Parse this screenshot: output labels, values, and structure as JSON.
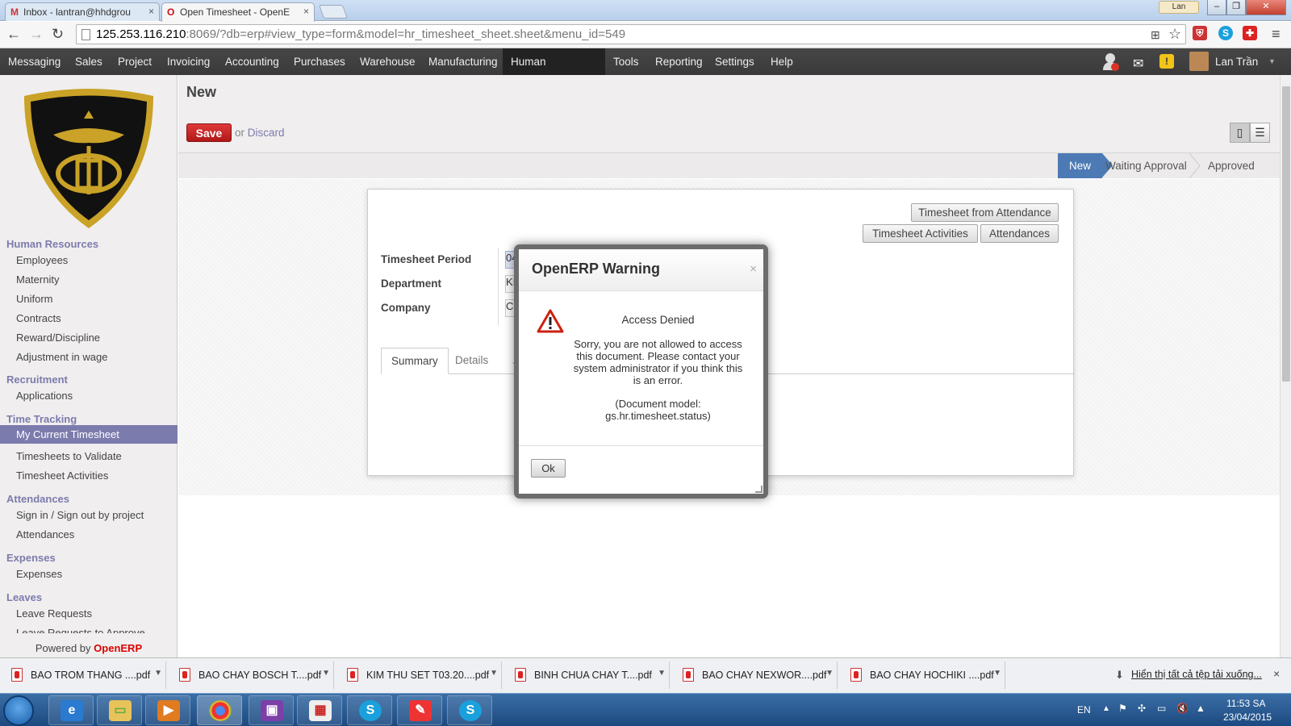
{
  "browser": {
    "tabs": [
      {
        "label": "Inbox - lantran@hhdgrou",
        "icon": "gmail-icon"
      },
      {
        "label": "Open Timesheet - OpenE",
        "icon": "opera-icon"
      }
    ],
    "user_chip": "Lan",
    "url_host": "125.253.116.210",
    "url_rest": ":8069/?db=erp#view_type=form&model=hr_timesheet_sheet.sheet&menu_id=549"
  },
  "topmenu": {
    "items": [
      "Messaging",
      "Sales",
      "Project",
      "Invoicing",
      "Accounting",
      "Purchases",
      "Warehouse",
      "Manufacturing",
      "Human Resources",
      "Tools",
      "Reporting",
      "Settings",
      "Help"
    ],
    "active": "Human Resources",
    "user_name": "Lan Trần"
  },
  "sidebar": {
    "sections": [
      {
        "title": "Human Resources",
        "items": [
          "Employees",
          "Maternity",
          "Uniform",
          "Contracts",
          "Reward/Discipline",
          "Adjustment in wage"
        ]
      },
      {
        "title": "Recruitment",
        "items": [
          "Applications"
        ]
      },
      {
        "title": "Time Tracking",
        "items": [
          "My Current Timesheet",
          "Timesheets to Validate",
          "Timesheet Activities"
        ]
      },
      {
        "title": "Attendances",
        "items": [
          "Sign in / Sign out by project",
          "Attendances"
        ]
      },
      {
        "title": "Expenses",
        "items": [
          "Expenses"
        ]
      },
      {
        "title": "Leaves",
        "items": [
          "Leave Requests",
          "Leave Requests to Approve"
        ]
      }
    ],
    "active_item": "My Current Timesheet",
    "powered_by": "Powered by",
    "powered_brand": "OpenERP"
  },
  "form": {
    "title": "New",
    "save_label": "Save",
    "or_label": "or",
    "discard_label": "Discard",
    "status_steps": [
      "New",
      "Waiting Approval",
      "Approved"
    ],
    "current_status": "New",
    "buttons": {
      "timesheet_from_attendance": "Timesheet from Attendance",
      "timesheet_activities": "Timesheet Activities",
      "attendances": "Attendances"
    },
    "fields": [
      {
        "label": "Timesheet Period",
        "value": "04"
      },
      {
        "label": "Department",
        "value": "KI"
      },
      {
        "label": "Company",
        "value": "Co"
      }
    ],
    "tabs": [
      "Summary",
      "Details",
      "A"
    ],
    "active_tab": "Summary"
  },
  "dialog": {
    "title": "OpenERP Warning",
    "close": "×",
    "heading": "Access Denied",
    "message_lines": [
      "Sorry, you are not allowed to access",
      "this document. Please contact your",
      "system administrator if you think this",
      "is an error."
    ],
    "model_lines": [
      "(Document model:",
      "gs.hr.timesheet.status)"
    ],
    "ok_label": "Ok"
  },
  "downloads": {
    "items": [
      "BAO TROM  THANG ....pdf",
      "BAO CHAY BOSCH T....pdf",
      "KIM THU SET T03.20....pdf",
      "BINH CHUA CHAY T....pdf",
      "BAO CHAY NEXWOR....pdf",
      "BAO CHAY HOCHIKI ....pdf"
    ],
    "show_all": "Hiển thị tất cả tệp tải xuống...",
    "close": "×"
  },
  "taskbar": {
    "lang": "EN",
    "time": "11:53 SA",
    "date": "23/04/2015"
  },
  "colors": {
    "menu_bg": "#414141",
    "sidebar_accent": "#7c7bad",
    "status_current": "#4d7ab5",
    "save_red": "#c62828"
  }
}
